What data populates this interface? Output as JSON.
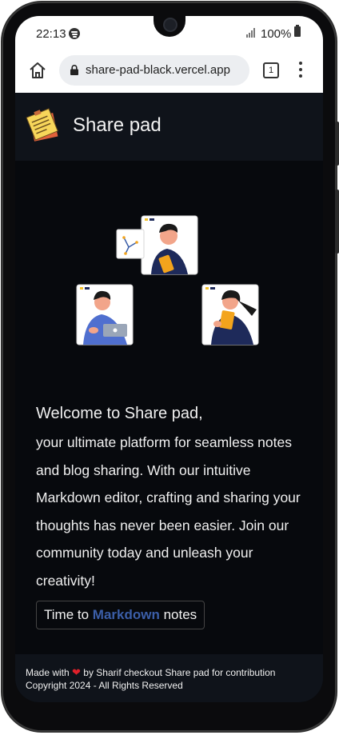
{
  "status_bar": {
    "time": "22:13",
    "battery": "100%",
    "spotify_icon": "spotify-icon",
    "signal_icon": "signal-icon",
    "battery_icon": "battery-icon"
  },
  "browser": {
    "url": "share-pad-black.vercel.app",
    "tab_count": "1",
    "home_icon": "home-icon",
    "lock_icon": "lock-icon",
    "menu_icon": "more-vert-icon"
  },
  "header": {
    "title": "Share pad",
    "logo_icon": "sticky-note-icon"
  },
  "hero": {
    "illustration": "people-collaborating-illustration"
  },
  "main": {
    "welcome": "Welcome to Share pad,",
    "description": "your ultimate platform for seamless notes and blog sharing. With our intuitive Markdown editor, crafting and sharing your thoughts has never been easier. Join our community today and unleash your creativity!",
    "cta_prefix": "Time to ",
    "cta_accent": "Markdown",
    "cta_suffix": " notes"
  },
  "footer": {
    "made_with": "Made with",
    "by_text": "by Sharif checkout Share pad for contribution",
    "copyright": "Copyright 2024 - All Rights Reserved",
    "heart_icon": "heart-icon"
  },
  "colors": {
    "background": "#07090d",
    "header_bg": "#0f131a",
    "accent": "#3b5ea8",
    "heart": "#e0202a"
  }
}
